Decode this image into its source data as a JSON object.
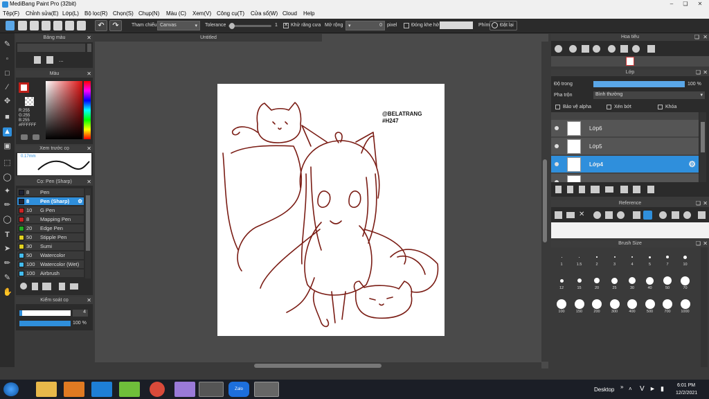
{
  "app": {
    "title": "MediBang Paint Pro (32bit)",
    "canvas_title": "Untitled"
  },
  "menu": [
    "Tệp(F)",
    "Chỉnh sửa(E)",
    "Lớp(L)",
    "Bộ lọc(R)",
    "Chọn(S)",
    "Chụp(N)",
    "Màu (C)",
    "Xem(V)",
    "Công cụ(T)",
    "Cửa sổ(W)",
    "Cloud",
    "Help"
  ],
  "toolbar": {
    "reference_label": "Tham chiếu",
    "reference_value": "Canvas",
    "tolerance_label": "Tolerance",
    "tolerance_value": "1",
    "antialias_label": "Khử răng cưa",
    "expand_label": "Mở rộng",
    "expand_value": "0",
    "expand_unit": "pixel",
    "close_gap_label": "Đóng khe hở",
    "key_label": "Phím",
    "reset_label": "Đặt lại"
  },
  "palette_panel": {
    "title": "Bảng màu",
    "ellipsis": "..."
  },
  "color_panel": {
    "title": "Màu",
    "r": "R:255",
    "g": "G:255",
    "b": "B:255",
    "hex": "#FFFFFF"
  },
  "preview_panel": {
    "title": "Xem trước cọ",
    "size": "0.17mm"
  },
  "brush_panel": {
    "title": "Cọ: Pen (Sharp)",
    "items": [
      {
        "size": "8",
        "name": "Pen",
        "color": "#1e2233"
      },
      {
        "size": "8",
        "name": "Pen (Sharp)",
        "color": "#1e2233"
      },
      {
        "size": "10",
        "name": "G Pen",
        "color": "#cc2222"
      },
      {
        "size": "8",
        "name": "Mapping Pen",
        "color": "#cc2222"
      },
      {
        "size": "20",
        "name": "Edge Pen",
        "color": "#22aa22"
      },
      {
        "size": "50",
        "name": "Stipple Pen",
        "color": "#e0d020"
      },
      {
        "size": "30",
        "name": "Sumi",
        "color": "#e0d020"
      },
      {
        "size": "50",
        "name": "Watercolor",
        "color": "#44bbee"
      },
      {
        "size": "100",
        "name": "Watercolor (Wet)",
        "color": "#44bbee"
      },
      {
        "size": "100",
        "name": "Airbrush",
        "color": "#44bbee"
      }
    ]
  },
  "brush_control": {
    "title": "Kiểm soát cọ",
    "size": "4",
    "opacity": "100 %"
  },
  "navigator": {
    "title": "Hoa tiêu"
  },
  "layer_panel": {
    "title": "Lớp",
    "opacity_label": "Độ trong",
    "opacity_value": "100 %",
    "blend_label": "Pha trộn",
    "blend_value": "Bình thường",
    "protect_alpha": "Bảo vệ alpha",
    "clipping": "Xén bớt",
    "lock": "Khóa",
    "layers": [
      {
        "name": "Lớp6"
      },
      {
        "name": "Lớp5"
      },
      {
        "name": "Lớp4"
      }
    ]
  },
  "reference_panel": {
    "title": "Reference"
  },
  "brush_size_panel": {
    "title": "Brush Size",
    "sizes": [
      "1",
      "1.5",
      "2",
      "3",
      "4",
      "5",
      "7",
      "10",
      "12",
      "15",
      "20",
      "25",
      "30",
      "40",
      "50",
      "70",
      "100",
      "150",
      "200",
      "300",
      "400",
      "500",
      "700",
      "1000"
    ]
  },
  "canvas_art": {
    "text_line1": "@BELATRANG",
    "text_line2": "#H247",
    "line_color": "#7a1c14"
  },
  "taskbar": {
    "desktop_label": "Desktop",
    "time": "6:01 PM",
    "date": "12/2/2021",
    "zalo": "Zalo"
  }
}
